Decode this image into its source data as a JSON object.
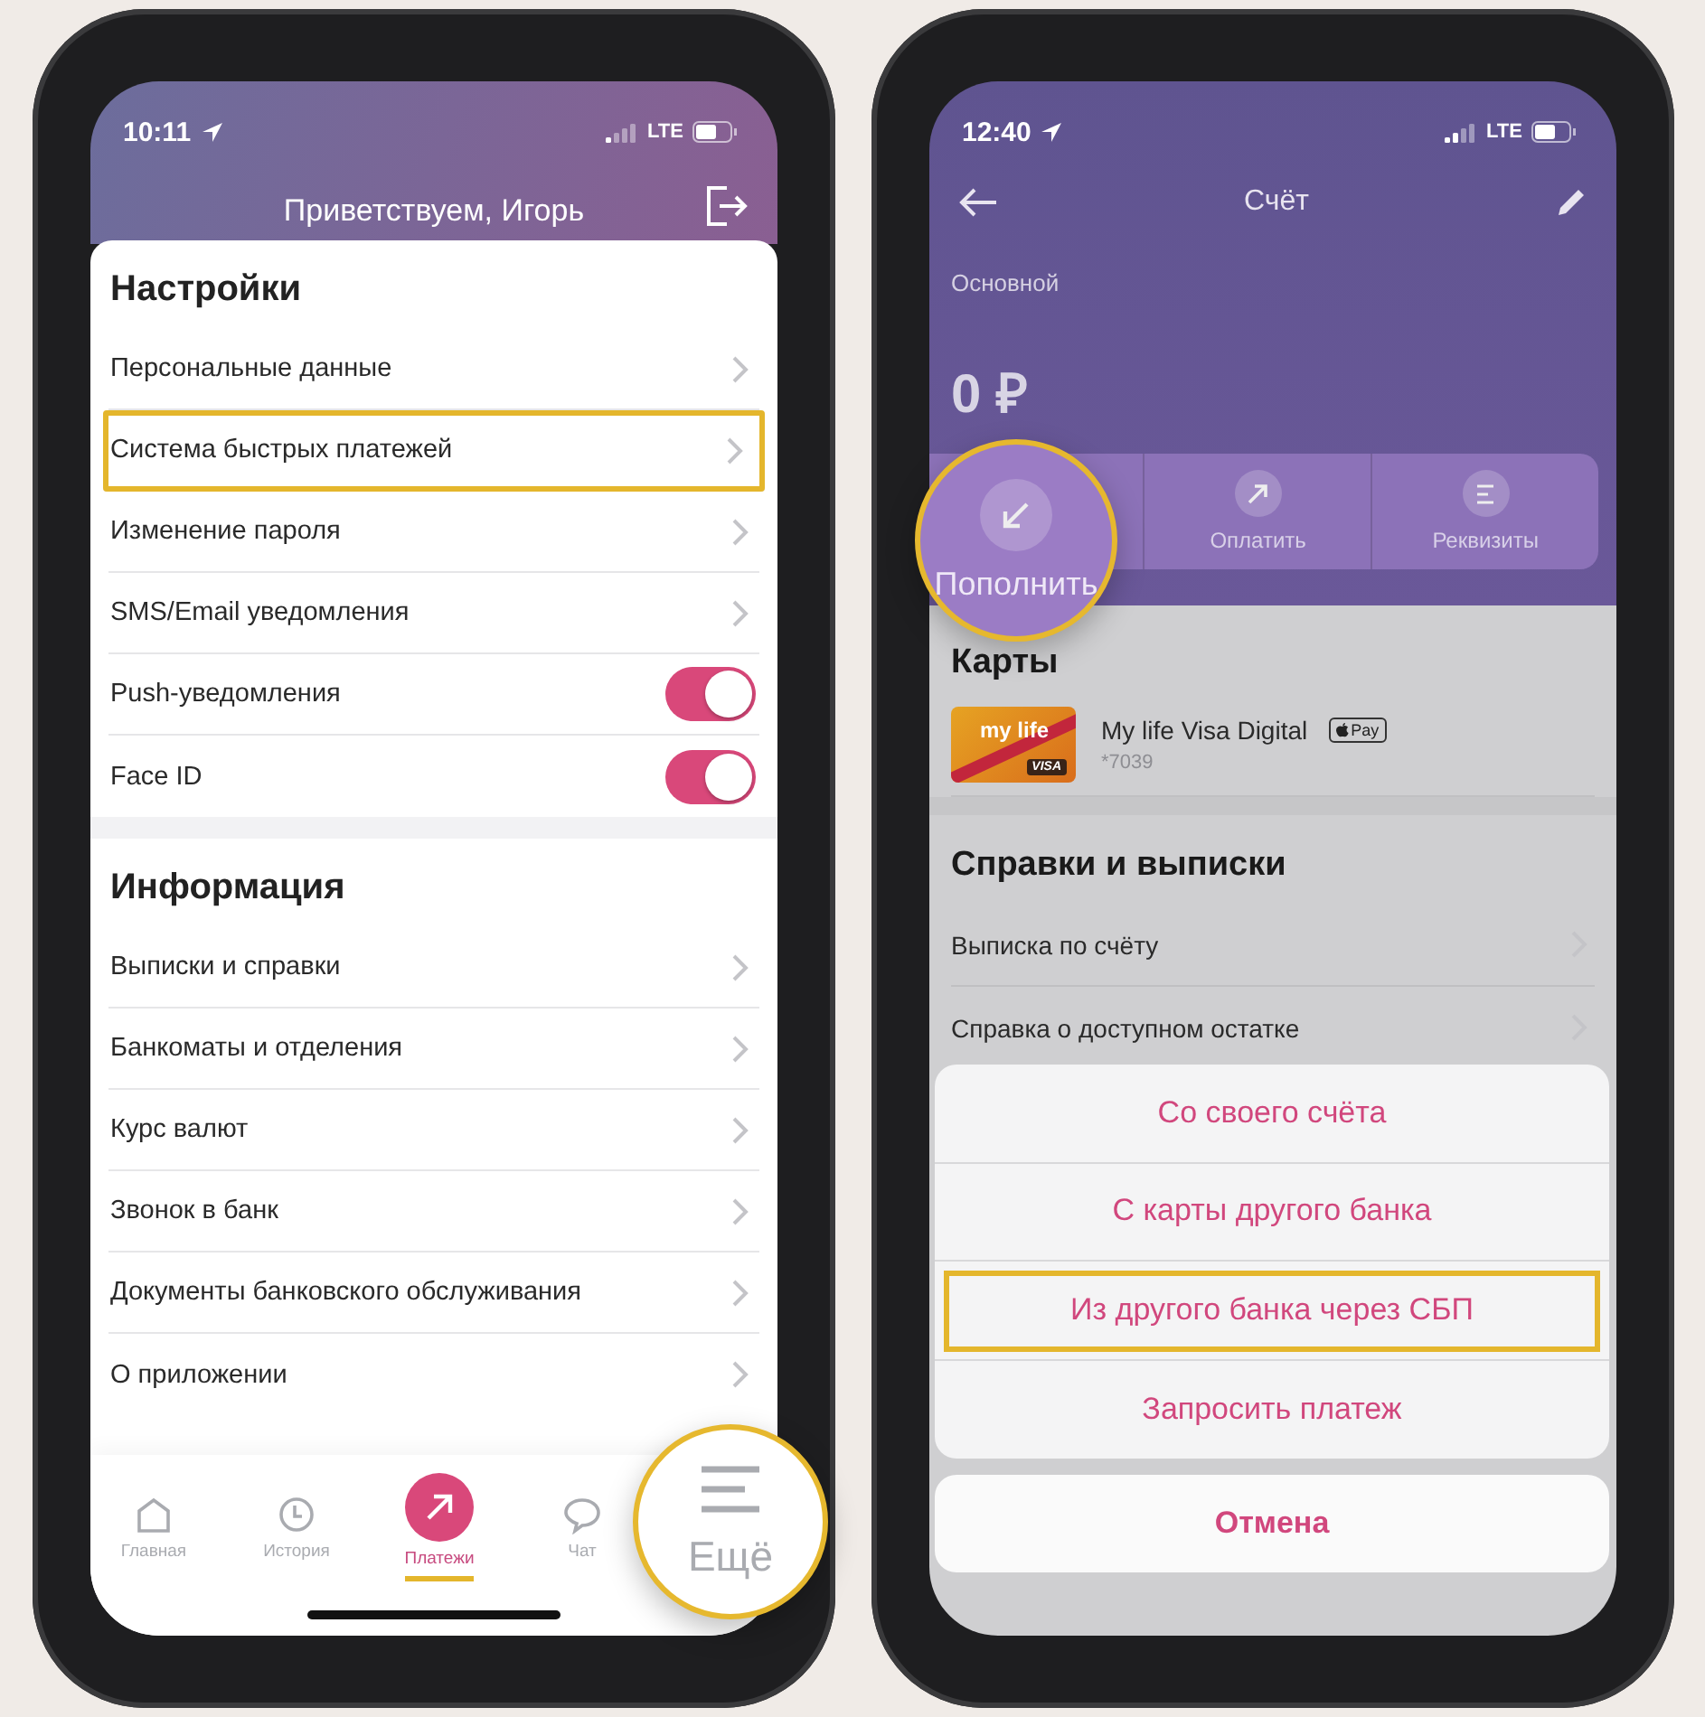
{
  "left_phone": {
    "status": {
      "time": "10:11",
      "network": "LTE"
    },
    "header": {
      "title": "Приветствуем, Игорь"
    },
    "sections": [
      {
        "title": "Настройки",
        "items": [
          {
            "label": "Персональные данные",
            "kind": "link",
            "highlighted": false
          },
          {
            "label": "Система быстрых платежей",
            "kind": "link",
            "highlighted": true
          },
          {
            "label": "Изменение пароля",
            "kind": "link",
            "highlighted": false
          },
          {
            "label": "SMS/Email уведомления",
            "kind": "link",
            "highlighted": false
          },
          {
            "label": "Push-уведомления",
            "kind": "toggle",
            "on": true,
            "highlighted": false
          },
          {
            "label": "Face ID",
            "kind": "toggle",
            "on": true,
            "highlighted": false
          }
        ]
      },
      {
        "title": "Информация",
        "items": [
          {
            "label": "Выписки и справки",
            "kind": "link",
            "highlighted": false
          },
          {
            "label": "Банкоматы и отделения",
            "kind": "link",
            "highlighted": false
          },
          {
            "label": "Курс валют",
            "kind": "link",
            "highlighted": false
          },
          {
            "label": "Звонок в банк",
            "kind": "link",
            "highlighted": false
          },
          {
            "label": "Документы банковского обслуживания",
            "kind": "link",
            "highlighted": false
          },
          {
            "label": "О приложении",
            "kind": "link",
            "highlighted": false
          }
        ]
      }
    ],
    "tab_bar": [
      {
        "label": "Главная",
        "kind": "home",
        "selected": false
      },
      {
        "label": "История",
        "kind": "history",
        "selected": false
      },
      {
        "label": "Платежи",
        "kind": "payments",
        "selected": true
      },
      {
        "label": "Чат",
        "kind": "chat",
        "selected": false
      }
    ],
    "more_callout": {
      "label": "Ещё"
    }
  },
  "right_phone": {
    "status": {
      "time": "12:40",
      "network": "LTE"
    },
    "header": {
      "title": "Счёт"
    },
    "account_name": "Основной",
    "balance": "0 ₽",
    "topup_callout": {
      "label": "Пополнить"
    },
    "actions": [
      {
        "label": "Оплатить",
        "kind": "pay"
      },
      {
        "label": "Реквизиты",
        "kind": "details"
      }
    ],
    "cards_title": "Карты",
    "card": {
      "art_label": "my life",
      "art_network": "VISA",
      "name": "My life Visa Digital",
      "badge": "Pay",
      "number": "*7039"
    },
    "statements": {
      "title": "Справки и выписки",
      "items": [
        "Выписка по счёту",
        "Справка о доступном остатке"
      ]
    },
    "sheet": {
      "options": [
        {
          "label": "Со своего счёта",
          "highlighted": false
        },
        {
          "label": "С карты другого банка",
          "highlighted": false
        },
        {
          "label": "Из другого банка через СБП",
          "highlighted": true
        },
        {
          "label": "Запросить платеж",
          "highlighted": false
        }
      ],
      "cancel": "Отмена"
    }
  }
}
